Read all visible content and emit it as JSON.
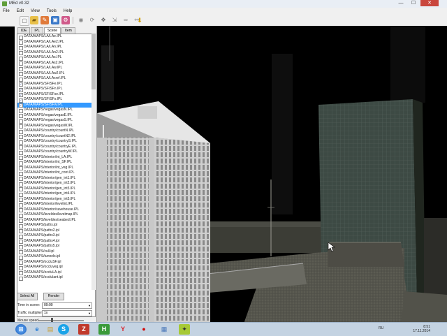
{
  "window": {
    "title": "MEd v0.32",
    "minimize": "—",
    "maximize": "☐",
    "close": "✕"
  },
  "menu": [
    "File",
    "Edit",
    "View",
    "Tools",
    "Help"
  ],
  "toolbar": {
    "icons": [
      "new-file-icon",
      "open-folder-icon",
      "paint-icon",
      "image-icon",
      "settings-icon",
      "select-icon",
      "rotate-icon",
      "move-icon",
      "scale-icon",
      "link-icon",
      "unlink-icon",
      "download-icon"
    ]
  },
  "sidebar": {
    "tabs": [
      "IDE",
      "IPL",
      "Scene",
      "Item"
    ],
    "active_tab": "Scene",
    "files": [
      {
        "name": "DATA/MAPS/LA/LAe.IPL",
        "checked": false,
        "selected": false
      },
      {
        "name": "DATA/MAPS/LA/LAe2.IPL",
        "checked": false,
        "selected": false
      },
      {
        "name": "DATA/MAPS/LA/LAn.IPL",
        "checked": false,
        "selected": false
      },
      {
        "name": "DATA/MAPS/LA/LAn2.IPL",
        "checked": false,
        "selected": false
      },
      {
        "name": "DATA/MAPS/LA/LAs.IPL",
        "checked": false,
        "selected": false
      },
      {
        "name": "DATA/MAPS/LA/LAs2.IPL",
        "checked": false,
        "selected": false
      },
      {
        "name": "DATA/MAPS/LA/LAw.IPL",
        "checked": false,
        "selected": false
      },
      {
        "name": "DATA/MAPS/LA/LAw2.IPL",
        "checked": false,
        "selected": false
      },
      {
        "name": "DATA/MAPS/LA/LAxref.IPL",
        "checked": false,
        "selected": false
      },
      {
        "name": "DATA/MAPS/SF/SFe.IPL",
        "checked": true,
        "selected": false
      },
      {
        "name": "DATA/MAPS/SF/SFn.IPL",
        "checked": true,
        "selected": false
      },
      {
        "name": "DATA/MAPS/SF/SFse.IPL",
        "checked": true,
        "selected": false
      },
      {
        "name": "DATA/MAPS/SF/SFs.IPL",
        "checked": true,
        "selected": false
      },
      {
        "name": "DATA/MAPS/SF/SFw.IPL",
        "checked": true,
        "selected": true
      },
      {
        "name": "DATA/MAPS/vegas/vegasN.IPL",
        "checked": false,
        "selected": false
      },
      {
        "name": "DATA/MAPS/vegas/vegasE.IPL",
        "checked": false,
        "selected": false
      },
      {
        "name": "DATA/MAPS/vegas/vegasS.IPL",
        "checked": false,
        "selected": false
      },
      {
        "name": "DATA/MAPS/vegas/vegasW.IPL",
        "checked": false,
        "selected": false
      },
      {
        "name": "DATA/MAPS/country/countN.IPL",
        "checked": false,
        "selected": false
      },
      {
        "name": "DATA/MAPS/country/countN2.IPL",
        "checked": false,
        "selected": false
      },
      {
        "name": "DATA/MAPS/country/countryS.IPL",
        "checked": false,
        "selected": false
      },
      {
        "name": "DATA/MAPS/country/countryE.IPL",
        "checked": false,
        "selected": false
      },
      {
        "name": "DATA/MAPS/country/countryW.IPL",
        "checked": false,
        "selected": false
      },
      {
        "name": "DATA/MAPS/interior/int_LA.IPL",
        "checked": false,
        "selected": false
      },
      {
        "name": "DATA/MAPS/interior/int_SF.IPL",
        "checked": false,
        "selected": false
      },
      {
        "name": "DATA/MAPS/interior/int_veg.IPL",
        "checked": false,
        "selected": false
      },
      {
        "name": "DATA/MAPS/interior/int_cont.IPL",
        "checked": false,
        "selected": false
      },
      {
        "name": "DATA/MAPS/interior/gen_int1.IPL",
        "checked": false,
        "selected": false
      },
      {
        "name": "DATA/MAPS/interior/gen_int2.IPL",
        "checked": false,
        "selected": false
      },
      {
        "name": "DATA/MAPS/interior/gen_int3.IPL",
        "checked": false,
        "selected": false
      },
      {
        "name": "DATA/MAPS/interior/gen_int4.IPL",
        "checked": false,
        "selected": false
      },
      {
        "name": "DATA/MAPS/interior/gen_int5.IPL",
        "checked": false,
        "selected": false
      },
      {
        "name": "DATA/MAPS/interior/levelint.IPL",
        "checked": false,
        "selected": false
      },
      {
        "name": "DATA/MAPS/interior/savehouse.IPL",
        "checked": false,
        "selected": false
      },
      {
        "name": "DATA/MAPS/leveldes/levelmap.IPL",
        "checked": false,
        "selected": false
      },
      {
        "name": "DATA/MAPS/leveldes/seabed.IPL",
        "checked": false,
        "selected": false
      },
      {
        "name": "DATA/MAPS/paths.ipl",
        "checked": false,
        "selected": false
      },
      {
        "name": "DATA/MAPS/paths2.ipl",
        "checked": false,
        "selected": false
      },
      {
        "name": "DATA/MAPS/paths3.ipl",
        "checked": false,
        "selected": false
      },
      {
        "name": "DATA/MAPS/paths4.ipl",
        "checked": false,
        "selected": false
      },
      {
        "name": "DATA/MAPS/paths5.ipl",
        "checked": false,
        "selected": false
      },
      {
        "name": "DATA/MAPS/cull.ipl",
        "checked": false,
        "selected": false
      },
      {
        "name": "DATA/MAPS/tunnels.ipl",
        "checked": false,
        "selected": false
      },
      {
        "name": "DATA/MAPS/occluSF.ipl",
        "checked": false,
        "selected": false
      },
      {
        "name": "DATA/MAPS/occluveg.ipl",
        "checked": false,
        "selected": false
      },
      {
        "name": "DATA/MAPS/occluLA.ipl",
        "checked": false,
        "selected": false
      },
      {
        "name": "DATA/MAPS/occlulant.ipl",
        "checked": false,
        "selected": false
      }
    ],
    "select_all": "Select All",
    "render": "Render",
    "time_label": "Time in scene:",
    "time_value": "09:00",
    "traffic_label": "Traffic multiplier:",
    "traffic_value": "1x",
    "mouse_label": "Mouse speed",
    "mouse_speed": 0.28
  },
  "taskbar": {
    "apps": [
      "start-icon",
      "ie-icon",
      "explorer-icon",
      "skype-icon",
      "filezilla-icon",
      "green-app-icon",
      "yandex-icon",
      "red-ball-icon",
      "photo-viewer-icon",
      "med-icon"
    ],
    "lang": "RU",
    "time": "8:51",
    "date": "17.11.2014"
  },
  "colors": {
    "accent": "#3399ff",
    "taskbar": "#c4d3e2",
    "sky": "#000000"
  }
}
